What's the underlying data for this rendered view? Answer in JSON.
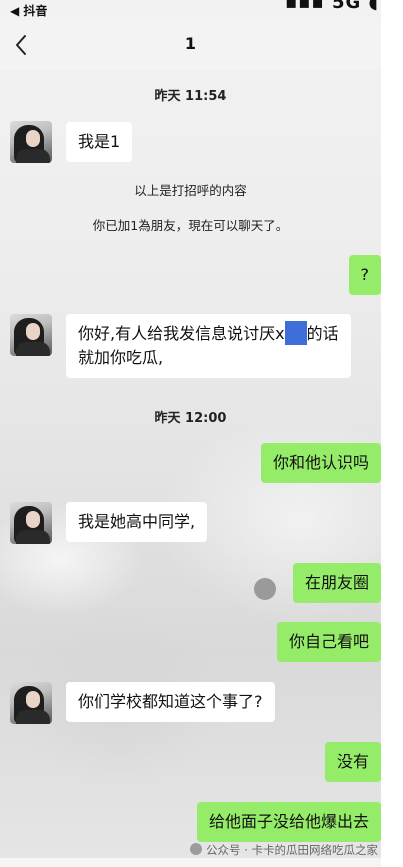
{
  "status_bar": {
    "back_app": "◀ 抖音",
    "signal": "▪▪▪ 5G ◖"
  },
  "nav": {
    "title": "1"
  },
  "timestamps": [
    "昨天 11:54",
    "昨天 12:00"
  ],
  "system_messages": [
    "以上是打招呼的内容",
    "你已加1為朋友，現在可以聊天了。"
  ],
  "messages": {
    "m1": {
      "side": "left",
      "text": "我是1"
    },
    "m2": {
      "side": "right",
      "text": "?"
    },
    "m3": {
      "side": "left",
      "line1_before": "你好,有人给我发信息说讨厌x",
      "line1_after": "的话",
      "line2": "就加你吃瓜,"
    },
    "m4": {
      "side": "right",
      "text": "你和他认识吗"
    },
    "m5": {
      "side": "left",
      "text": "我是她高中同学,"
    },
    "m6": {
      "side": "right",
      "text": "在朋友圈"
    },
    "m7": {
      "side": "right",
      "text": "你自己看吧"
    },
    "m8": {
      "side": "left",
      "text": "你们学校都知道这个事了?"
    },
    "m9": {
      "side": "right",
      "text": "没有"
    },
    "m10": {
      "side": "right",
      "text": "给他面子没给他爆出去"
    }
  },
  "watermark": {
    "text": "公众号 · 卡卡的瓜田网络吃瓜之家"
  },
  "colors": {
    "sent_bubble": "#95ec69",
    "received_bubble": "#ffffff",
    "censor_box": "#3e6fd8"
  }
}
